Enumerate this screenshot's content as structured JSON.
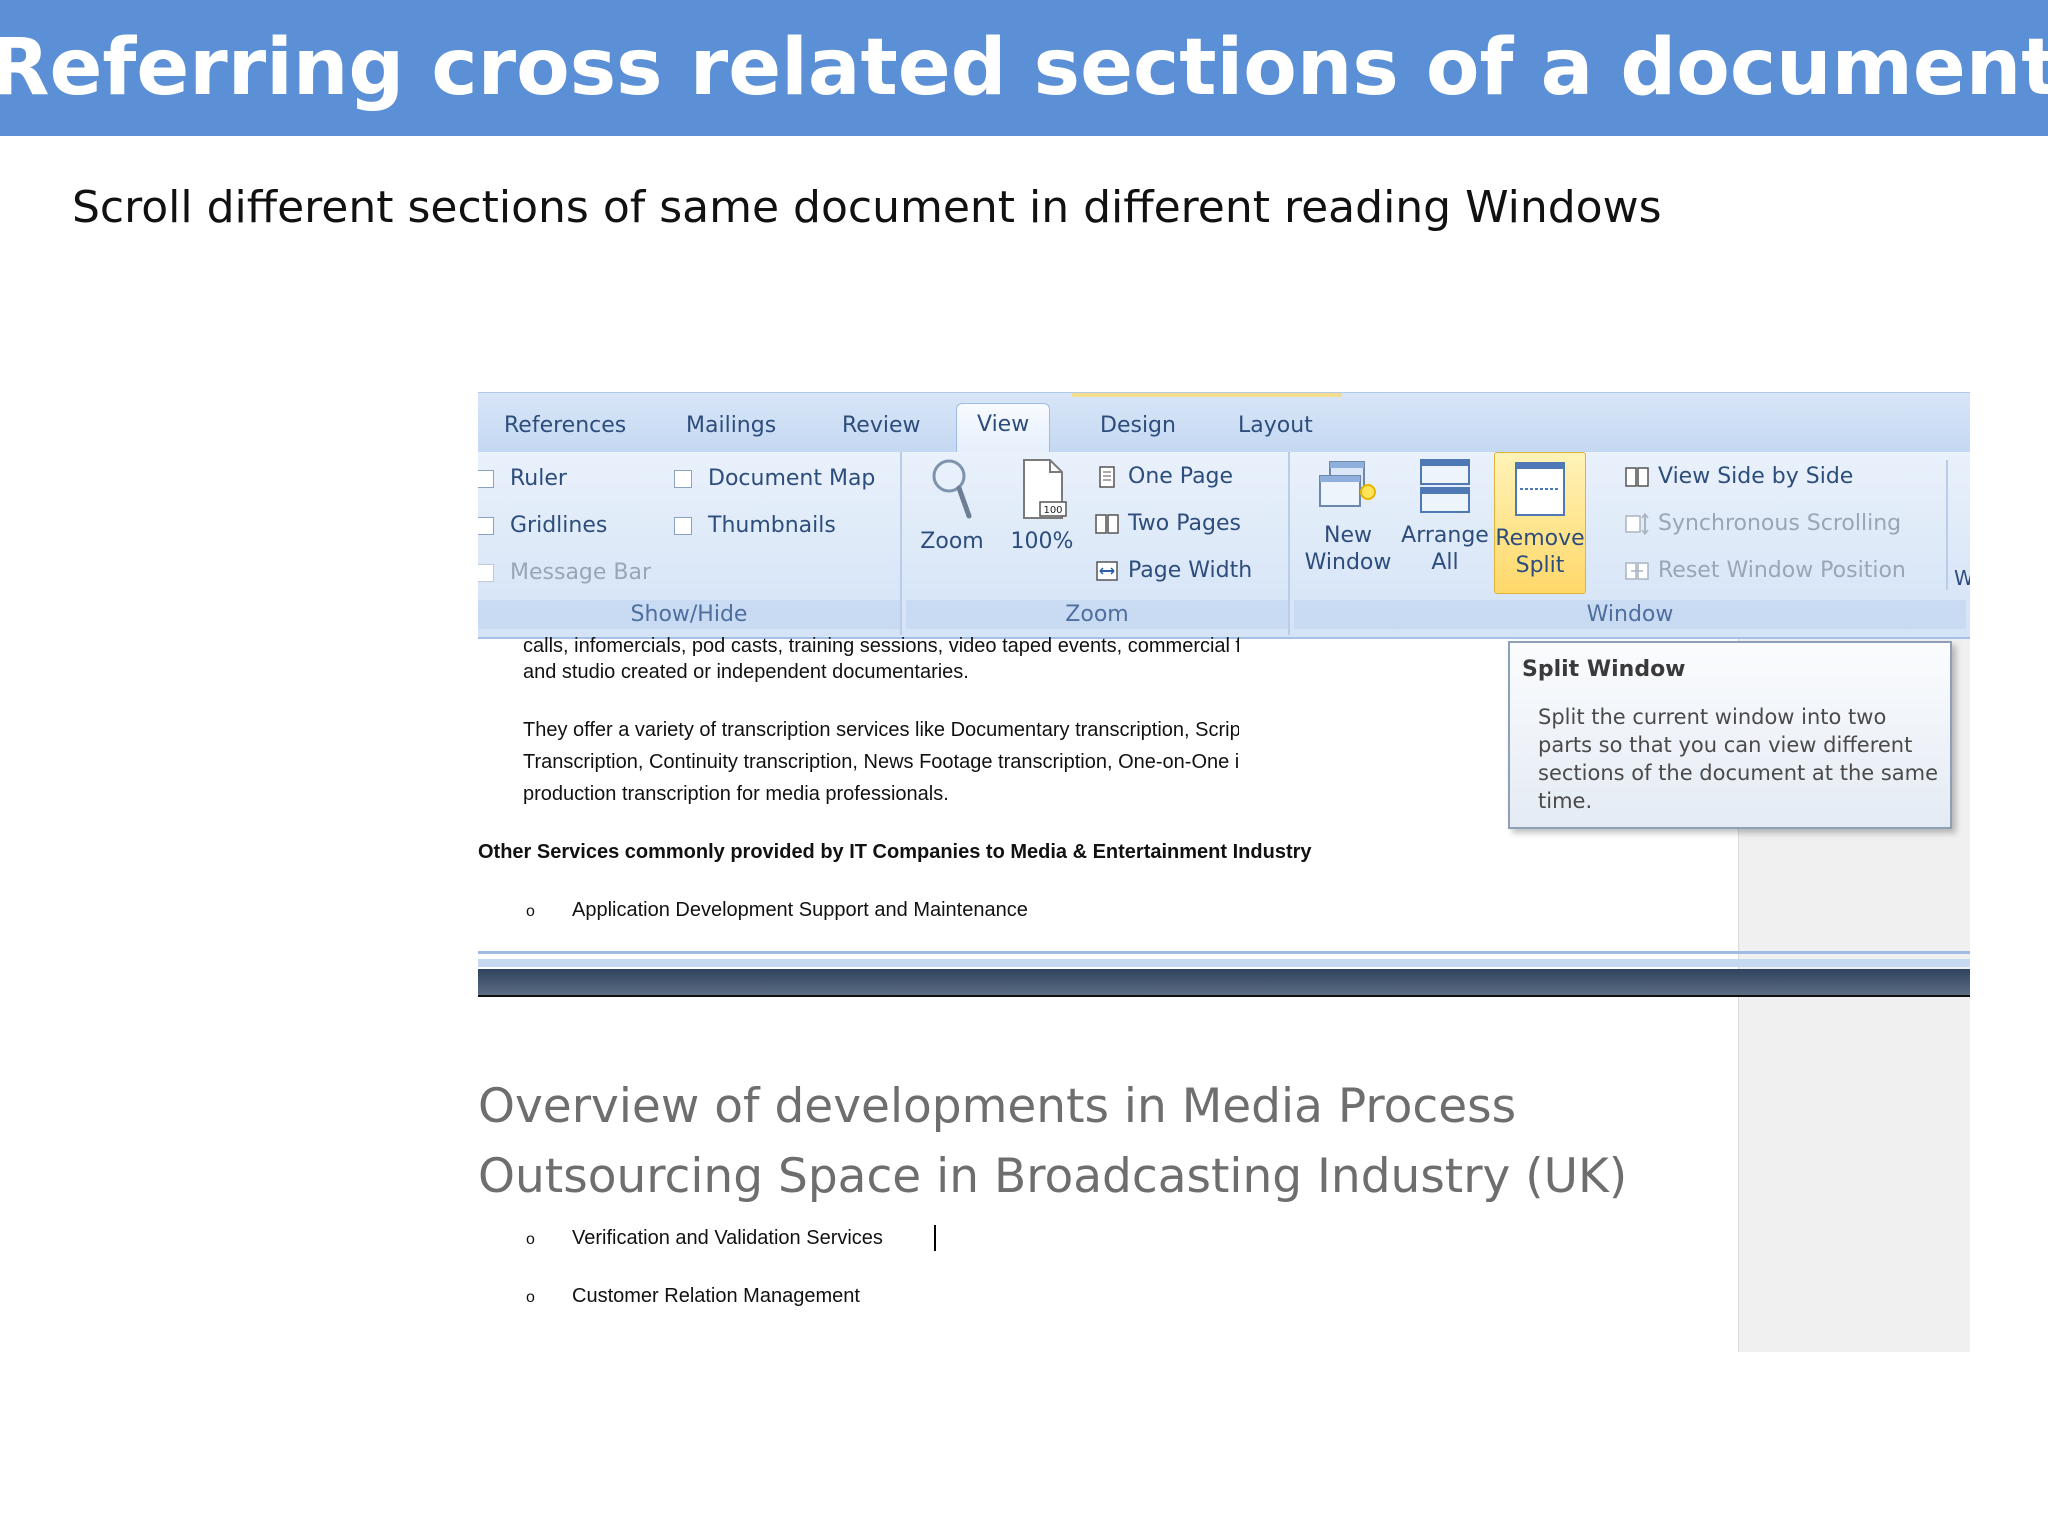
{
  "slide": {
    "title": "Referring cross related sections of a document",
    "subtitle": "Scroll different sections of same document in different reading Windows"
  },
  "ribbon": {
    "tabs": [
      "References",
      "Mailings",
      "Review",
      "View",
      "Design",
      "Layout"
    ],
    "active_tab": "View",
    "show_hide": {
      "label": "Show/Hide",
      "ruler": "Ruler",
      "gridlines": "Gridlines",
      "message_bar": "Message Bar",
      "document_map": "Document Map",
      "thumbnails": "Thumbnails"
    },
    "zoom": {
      "label": "Zoom",
      "zoom_btn": "Zoom",
      "hundred_btn": "100%",
      "hundred_icon_text": "100",
      "one_page": "One Page",
      "two_pages": "Two Pages",
      "page_width": "Page Width"
    },
    "window": {
      "label": "Window",
      "new_window_1": "New",
      "new_window_2": "Window",
      "arrange_all_1": "Arrange",
      "arrange_all_2": "All",
      "remove_split_1": "Remove",
      "remove_split_2": "Split",
      "view_side_by_side": "View Side by Side",
      "sync_scrolling": "Synchronous Scrolling",
      "reset_window": "Reset Window Position",
      "cut_off": "W"
    }
  },
  "document": {
    "line1": "calls, infomercials, pod casts, training sessions, video taped events, commercial films, ente",
    "line2": "and studio created or independent documentaries.",
    "para2_line1": "They offer a variety of transcription services like Documentary transcription, Script transcriptio",
    "para2_line2": "Transcription, Continuity transcription, News Footage transcription, One-on-One interview",
    "para2_line3": "production transcription for media professionals.",
    "bold_heading": "Other Services commonly provided by IT Companies to Media & Entertainment Industry",
    "bullet_marker": "o",
    "item1": "Application Development Support and Maintenance",
    "big_heading_line1": "Overview of developments in Media Process",
    "big_heading_line2": "Outsourcing Space in Broadcasting Industry (UK)",
    "item2": "Verification and Validation Services",
    "item3": "Customer Relation Management"
  },
  "tooltip": {
    "title": "Split Window",
    "body": "Split the current window into two parts so that you can view different sections of the document at the same time."
  }
}
